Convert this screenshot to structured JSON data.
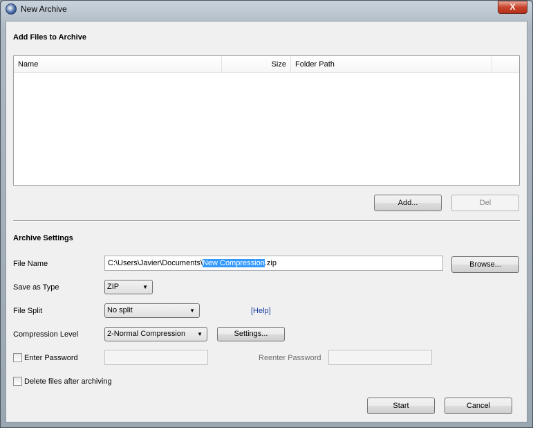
{
  "window": {
    "title": "New Archive",
    "close": "X"
  },
  "files": {
    "heading": "Add Files to Archive",
    "columns": [
      "Name",
      "Size",
      "Folder Path"
    ],
    "add": "Add...",
    "del": "Del"
  },
  "settings": {
    "heading": "Archive Settings",
    "file_name_label": "File Name",
    "file_name_prefix": "C:\\Users\\Javier\\Documents\\",
    "file_name_selected": "New Compression",
    "file_name_suffix": ".zip",
    "browse": "Browse...",
    "type_label": "Save as Type",
    "type_value": "ZIP",
    "split_label": "File Split",
    "split_value": "No split",
    "help": "[Help]",
    "level_label": "Compression Level",
    "level_value": "2-Normal Compression",
    "settings_btn": "Settings...",
    "password_label": "Enter Password",
    "reenter_label": "Reenter Password",
    "delete_label": "Delete files after archiving"
  },
  "footer": {
    "start": "Start",
    "cancel": "Cancel"
  }
}
